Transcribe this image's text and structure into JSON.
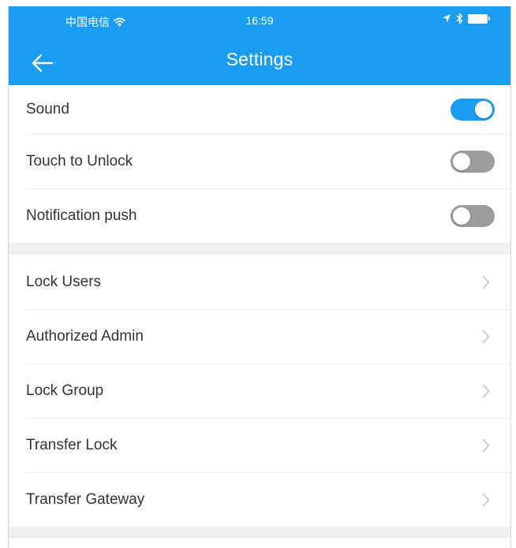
{
  "status_bar": {
    "carrier": "中国电信",
    "time": "16:59",
    "icons": [
      "wifi-icon",
      "location-arrow-icon",
      "bluetooth-icon",
      "battery-icon"
    ]
  },
  "header": {
    "title": "Settings",
    "back_icon": "arrow-left-icon"
  },
  "colors": {
    "accent": "#1a9cf2",
    "toggle_off": "#9c9c9c",
    "section_gap": "#f0f0f0",
    "text": "#333333",
    "chevron": "#c2c2c2"
  },
  "toggles": [
    {
      "label": "Sound",
      "on": true
    },
    {
      "label": "Touch to Unlock",
      "on": false
    },
    {
      "label": "Notification push",
      "on": false
    }
  ],
  "menu": [
    {
      "label": "Lock Users"
    },
    {
      "label": "Authorized Admin"
    },
    {
      "label": "Lock Group"
    },
    {
      "label": "Transfer Lock"
    },
    {
      "label": "Transfer Gateway"
    }
  ]
}
